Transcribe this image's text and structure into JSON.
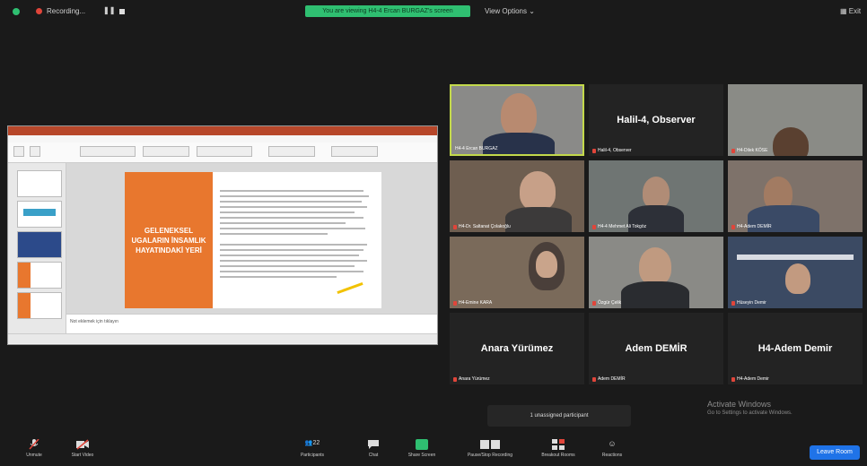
{
  "topbar": {
    "recording_label": "Recording...",
    "share_banner": "You are viewing H4-4 Ercan BURGAZ's screen",
    "view_options": "View Options ⌄",
    "exit_label": "Exit"
  },
  "slide": {
    "title": "GELENEKSEL UGALARIN İNSAMLIK HAYATINDAKİ YERİ",
    "notes_placeholder": "Not eklemek için tıklayın"
  },
  "participants": [
    {
      "name": "H4-4 Ercan BURGAZ",
      "video": true,
      "active": true
    },
    {
      "name": "Halil-4, Observer",
      "video": false,
      "muted": true
    },
    {
      "name": "H4-Dilek KÖSE",
      "video": true,
      "muted": true
    },
    {
      "name": "H4-Dr. Saltanat Çolakoğlu",
      "video": true,
      "muted": true
    },
    {
      "name": "H4-4 Mehmet Ali Tokgöz",
      "video": true,
      "muted": true
    },
    {
      "name": "H4-Adem DEMİR",
      "video": true,
      "muted": true
    },
    {
      "name": "H4-Emine KARA",
      "video": true,
      "muted": true
    },
    {
      "name": "Özgür Çelik",
      "video": true,
      "muted": true
    },
    {
      "name": "Hüseyin Demir",
      "video": true,
      "muted": true
    },
    {
      "name": "Anara Yürümez",
      "video": false,
      "muted": true
    },
    {
      "name": "Adem DEMİR",
      "video": false,
      "muted": true
    },
    {
      "name": "H4-Adem Demir",
      "video": false,
      "muted": true
    }
  ],
  "unassigned": "1 unassigned participant",
  "watermark": {
    "title": "Activate Windows",
    "subtitle": "Go to Settings to activate Windows."
  },
  "toolbar": {
    "unmute": "Unmute",
    "start_video": "Start Video",
    "participants": "Participants",
    "participants_count": "22",
    "chat": "Chat",
    "share_screen": "Share Screen",
    "pause_recording": "Pause/Stop Recording",
    "breakout_rooms": "Breakout Rooms",
    "reactions": "Reactions",
    "leave": "Leave Room"
  },
  "colors": {
    "accent_green": "#2fbf71",
    "active_speaker": "#c3d94b",
    "leave_blue": "#1f73e8",
    "slide_orange": "#e8772e"
  }
}
